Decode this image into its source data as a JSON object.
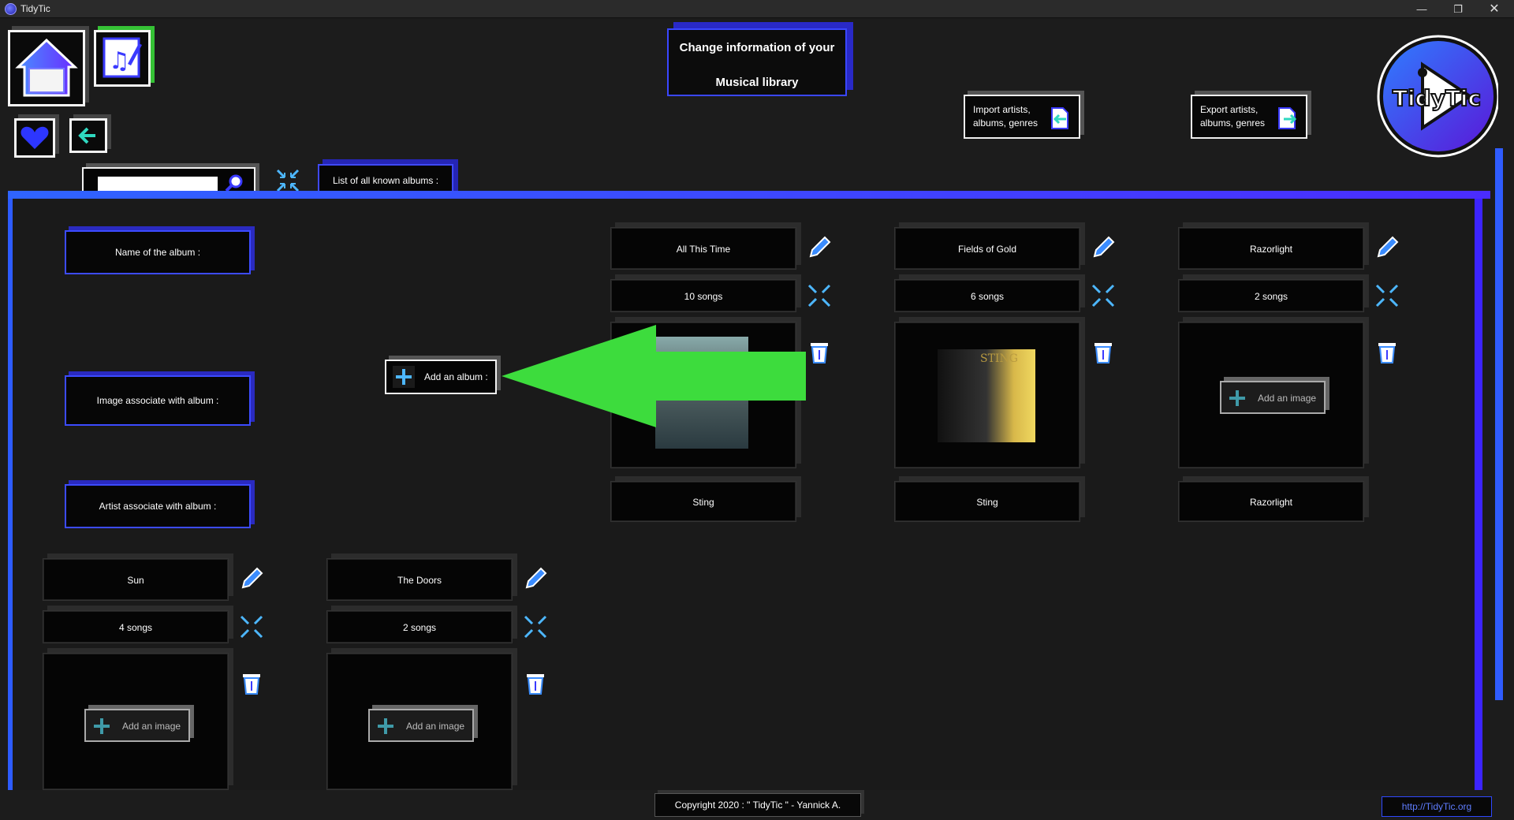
{
  "window": {
    "title": "TidyTic",
    "controls": {
      "minimize": "—",
      "maximize": "❐",
      "close": "✕"
    }
  },
  "nav": {
    "home_icon": "home-icon",
    "music_icon": "music-edit-icon",
    "favorite_icon": "heart-icon",
    "back_icon": "arrow-left-icon"
  },
  "header": {
    "line1": "Change information of your",
    "line2": "Musical library"
  },
  "import": {
    "line1": "Import artists,",
    "line2": "albums, genres"
  },
  "export": {
    "line1": "Export artists,",
    "line2": "albums, genres"
  },
  "logo": {
    "text": "TidyTic"
  },
  "search": {
    "value": "",
    "placeholder": ""
  },
  "tab": {
    "label": "List of all known albums :"
  },
  "form": {
    "name_label": "Name of the album :",
    "image_label": "Image associate with album :",
    "artist_label": "Artist associate with album :",
    "add_album_label": "Add an album :"
  },
  "albums": [
    {
      "title": "All This Time",
      "songs": "10 songs",
      "artist": "Sting",
      "has_cover": true
    },
    {
      "title": "Fields of Gold",
      "songs": "6 songs",
      "artist": "Sting",
      "has_cover": true,
      "cover_text": "STING"
    },
    {
      "title": "Razorlight",
      "songs": "2 songs",
      "artist": "Razorlight",
      "has_cover": false
    },
    {
      "title": "Sun",
      "songs": "4 songs",
      "artist": "",
      "has_cover": false
    },
    {
      "title": "The Doors",
      "songs": "2 songs",
      "artist": "",
      "has_cover": false
    }
  ],
  "add_image_label": "Add an image",
  "footer": {
    "copyright": "Copyright 2020 : \" TidyTic \" - Yannick A.",
    "link": "http://TidyTic.org"
  },
  "colors": {
    "accent_blue": "#2f5cff",
    "accent_purple": "#3c24ff",
    "arrow_green": "#3ddc3d",
    "background": "#1c1c1c"
  }
}
